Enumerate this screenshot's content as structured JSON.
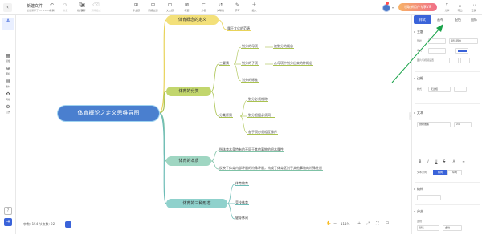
{
  "topbar": {
    "back_label": "‹",
    "title": "新建文件",
    "subtitle": "最后保存于 17:16:55",
    "buttons": [
      {
        "icon": "↶",
        "label": "撤销"
      },
      {
        "icon": "↷",
        "label": "恢复"
      },
      {
        "icon": "⎘",
        "label": "格式刷"
      },
      {
        "icon": "⌫",
        "label": "清除格式"
      },
      {
        "icon": "▣",
        "label": "保存"
      },
      {
        "icon": "⊞",
        "label": "子主题"
      },
      {
        "icon": "⊟",
        "label": "同级主题"
      },
      {
        "icon": "⊡",
        "label": "父主题"
      },
      {
        "icon": "⊠",
        "label": "概要"
      },
      {
        "icon": "⊏",
        "label": "外框"
      },
      {
        "icon": "↺",
        "label": "关联线"
      },
      {
        "icon": "✎",
        "label": "手写"
      },
      {
        "icon": "＋",
        "label": "插入"
      }
    ],
    "vip_label": "领取新用户专享VIP",
    "right_buttons": [
      {
        "icon": "⇪",
        "label": "分享"
      },
      {
        "icon": "⤓",
        "label": "导出"
      },
      {
        "icon": "⋯",
        "label": "更多"
      }
    ]
  },
  "leftbar": {
    "items": [
      {
        "icon": "A",
        "label": ""
      },
      {
        "icon": "▦",
        "label": "模板"
      },
      {
        "icon": "⊕",
        "label": "图标"
      },
      {
        "icon": "▤",
        "label": "素材"
      },
      {
        "icon": "✿",
        "label": "风格"
      },
      {
        "icon": "⚙",
        "label": "公式"
      }
    ]
  },
  "panel": {
    "tabs": [
      "样式",
      "画布",
      "配色",
      "图标"
    ],
    "active_tab": "样式",
    "sections": {
      "theme": "主题",
      "border": "边框",
      "text": "文本",
      "structure": "结构",
      "branch": "分支"
    },
    "theme_rows": {
      "shape_label": "形状",
      "shape_value": "默认圆角",
      "fill_label": "填充",
      "image_label": "图片与视频设置"
    },
    "border_rows": {
      "style_label": "样式",
      "style_value": "无边框"
    },
    "text_rows": {
      "font": "微软雅黑",
      "size": "24",
      "style_label": "文本方向",
      "seg1": "横向",
      "seg2": "纵向"
    },
    "branch_rows": {
      "label": "连线",
      "value": "默认",
      "value2": "曲线"
    }
  },
  "mindmap": {
    "root": "体育概论之定义思维导图",
    "topics": [
      {
        "label": "体育概念的定义",
        "children": [
          "属于文化的范畴"
        ]
      },
      {
        "label": "体育的分类",
        "children": [
          {
            "label": "三要素",
            "children": [
              {
                "label": "划分的母项",
                "children": [
                  "被划分的概念"
                ]
              },
              {
                "label": "划分的子项",
                "children": [
                  "从母项中划分出来的种概念"
                ]
              },
              {
                "label": "划分的标准",
                "children": []
              }
            ]
          },
          {
            "label": "分类原则",
            "children": [
              {
                "label": "划分必须相称",
                "children": []
              },
              {
                "label": "划分根据必须同一",
                "children": []
              },
              {
                "label": "各子项必须相互排斥",
                "children": []
              }
            ]
          }
        ]
      },
      {
        "label": "体育的本质",
        "children": [
          "指体育本身特有的不同于其他事物的根本属性",
          "反映了体育内部矛盾的特殊矛盾，构成了体育区别于其他事物的特殊性质"
        ]
      },
      {
        "label": "体育的三种形态",
        "children": [
          "体育教育",
          "竞技体育",
          "健身休闲"
        ]
      }
    ]
  },
  "colors": {
    "root": "#4a7fcf",
    "branch1": "#e8d35a",
    "branch2": "#a9c24e",
    "branch3": "#7fc2a6",
    "branch4": "#6cbcb6",
    "accent": "#3a63d9",
    "annotation_arrow": "#1aa34a"
  },
  "statusbar": {
    "count": "字数: 154   节点数: 22",
    "zoom": "111%"
  }
}
